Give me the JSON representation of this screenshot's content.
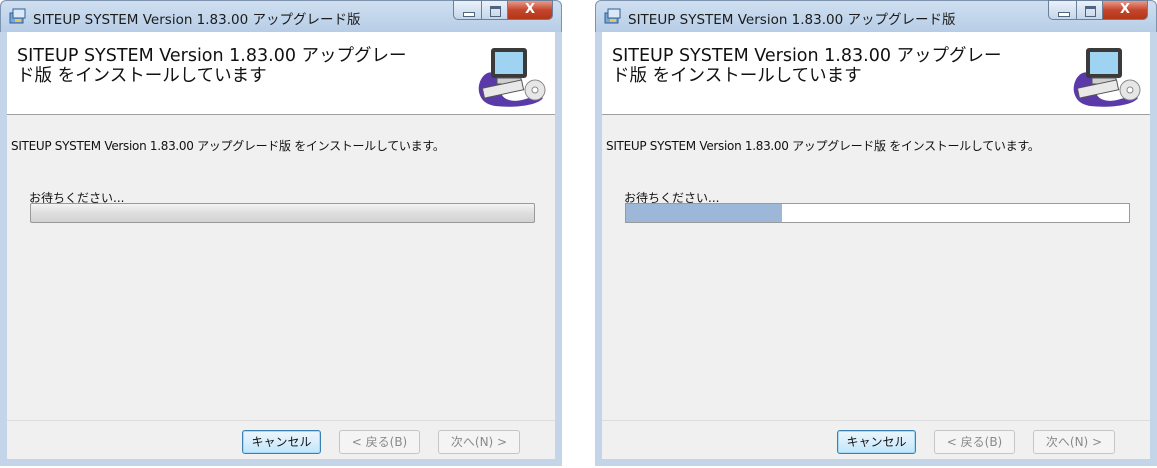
{
  "windows": [
    {
      "title": "SITEUP SYSTEM Version 1.83.00 アップグレード版",
      "close_glyph": "X",
      "header_title": "SITEUP SYSTEM Version 1.83.00 アップグレード版 をインストールしています",
      "body_text": "SITEUP SYSTEM Version 1.83.00 アップグレード版 をインストールしています。",
      "wait_label": "お待ちください...",
      "progress_fraction": 0,
      "buttons": {
        "cancel": "キャンセル",
        "back": "< 戻る(B)",
        "next": "次へ(N) >"
      }
    },
    {
      "title": "SITEUP SYSTEM Version 1.83.00 アップグレード版",
      "close_glyph": "X",
      "header_title": "SITEUP SYSTEM Version 1.83.00 アップグレード版 をインストールしています",
      "body_text": "SITEUP SYSTEM Version 1.83.00 アップグレード版 をインストールしています。",
      "wait_label": "お待ちください...",
      "progress_fraction": 0.31,
      "buttons": {
        "cancel": "キャンセル",
        "back": "< 戻る(B)",
        "next": "次へ(N) >"
      }
    }
  ],
  "icons": {
    "app": "installer-icon",
    "header": "computer-setup-icon"
  },
  "colors": {
    "progress_fill": "#9cb7d8",
    "title_bar": "#c4d5e9",
    "close_button": "#c4462d"
  }
}
